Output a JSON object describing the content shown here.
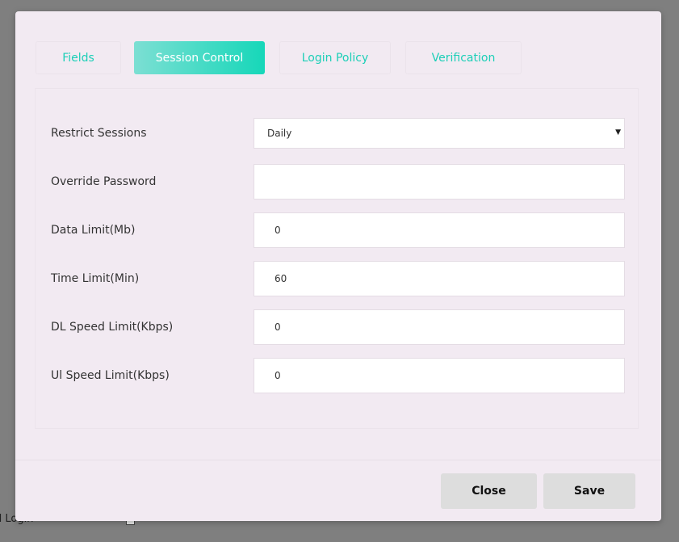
{
  "background": {
    "partial_label": "d Login"
  },
  "tabs": [
    {
      "label": "Fields",
      "active": false
    },
    {
      "label": "Session Control",
      "active": true
    },
    {
      "label": "Login Policy",
      "active": false
    },
    {
      "label": "Verification",
      "active": false
    }
  ],
  "form": {
    "restrict_sessions": {
      "label": "Restrict Sessions",
      "value": "Daily"
    },
    "override_password": {
      "label": "Override Password",
      "value": ""
    },
    "data_limit": {
      "label": "Data Limit(Mb)",
      "value": "0"
    },
    "time_limit": {
      "label": "Time Limit(Min)",
      "value": "60"
    },
    "dl_speed_limit": {
      "label": "DL Speed Limit(Kbps)",
      "value": "0"
    },
    "ul_speed_limit": {
      "label": "Ul Speed Limit(Kbps)",
      "value": "0"
    }
  },
  "footer": {
    "close_label": "Close",
    "save_label": "Save"
  },
  "colors": {
    "accent": "#16d7b9",
    "modal_bg": "#f2eaf2",
    "overlay": "#7f7f7f",
    "button_bg": "#dddddd"
  },
  "icons": {
    "select_caret": "caret-down-icon"
  }
}
